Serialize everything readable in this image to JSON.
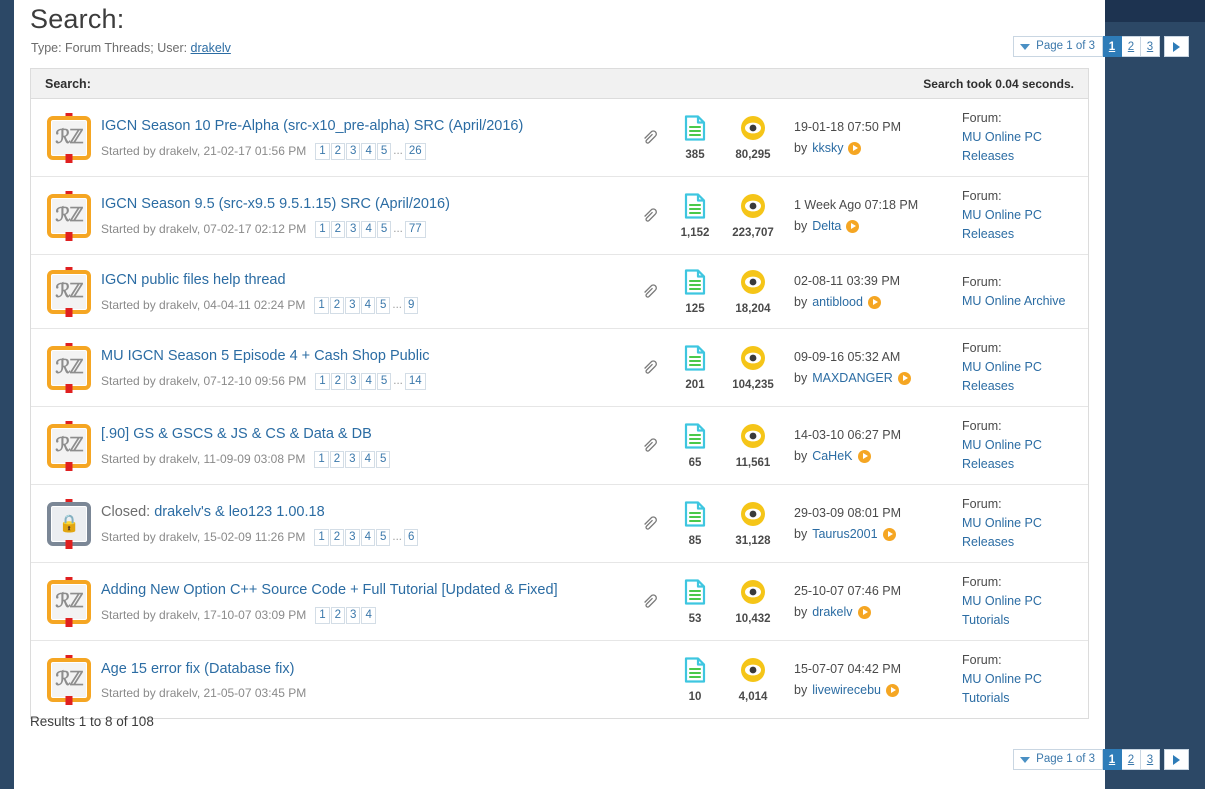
{
  "header": {
    "title": "Search:",
    "subline_prefix": "Type: Forum Threads; User: ",
    "subline_user": "drakelv"
  },
  "pagination": {
    "page_label": "Page 1 of 3",
    "pages": [
      "1",
      "2",
      "3"
    ],
    "active_page": "1",
    "next_label": "▶"
  },
  "panel": {
    "heading": "Search:",
    "took": "Search took 0.04 seconds."
  },
  "icons": {
    "thread_glyph": "ℛℤ",
    "closed_glyph": "🔒",
    "attachment": "paperclip-icon",
    "replies": "document-icon",
    "views": "eye-icon",
    "goto": "goto-arrow-icon"
  },
  "labels": {
    "forum_prefix": "Forum:",
    "by_prefix": "by",
    "results_count": "Results 1 to 8 of 108",
    "dots": "..."
  },
  "results": [
    {
      "icon": "thread",
      "closed_prefix": "",
      "title": "IGCN Season 10 Pre-Alpha (src-x10_pre-alpha) SRC (April/2016)",
      "started": "Started by drakelv, 21-02-17 01:56 PM",
      "minipages": [
        "1",
        "2",
        "3",
        "4",
        "5"
      ],
      "last_minipage": "26",
      "has_attachment": true,
      "replies": "385",
      "views": "80,295",
      "last_post_date": "19-01-18 07:50 PM",
      "last_post_user": "kksky",
      "forum": "MU Online PC Releases"
    },
    {
      "icon": "thread",
      "closed_prefix": "",
      "title": "IGCN Season 9.5 (src-x9.5 9.5.1.15) SRC (April/2016)",
      "started": "Started by drakelv, 07-02-17 02:12 PM",
      "minipages": [
        "1",
        "2",
        "3",
        "4",
        "5"
      ],
      "last_minipage": "77",
      "has_attachment": true,
      "replies": "1,152",
      "views": "223,707",
      "last_post_date": "1 Week Ago 07:18 PM",
      "last_post_user": "Delta",
      "forum": "MU Online PC Releases"
    },
    {
      "icon": "thread",
      "closed_prefix": "",
      "title": "IGCN public files help thread",
      "started": "Started by drakelv, 04-04-11 02:24 PM",
      "minipages": [
        "1",
        "2",
        "3",
        "4",
        "5"
      ],
      "last_minipage": "9",
      "has_attachment": true,
      "replies": "125",
      "views": "18,204",
      "last_post_date": "02-08-11 03:39 PM",
      "last_post_user": "antiblood",
      "forum": "MU Online Archive"
    },
    {
      "icon": "thread",
      "closed_prefix": "",
      "title": "MU IGCN Season 5 Episode 4 + Cash Shop Public",
      "started": "Started by drakelv, 07-12-10 09:56 PM",
      "minipages": [
        "1",
        "2",
        "3",
        "4",
        "5"
      ],
      "last_minipage": "14",
      "has_attachment": true,
      "replies": "201",
      "views": "104,235",
      "last_post_date": "09-09-16 05:32 AM",
      "last_post_user": "MAXDANGER",
      "forum": "MU Online PC Releases"
    },
    {
      "icon": "thread",
      "closed_prefix": "",
      "title": "[.90] GS & GSCS & JS & CS & Data & DB",
      "started": "Started by drakelv, 11-09-09 03:08 PM",
      "minipages": [
        "1",
        "2",
        "3",
        "4",
        "5"
      ],
      "last_minipage": "",
      "has_attachment": true,
      "replies": "65",
      "views": "11,561",
      "last_post_date": "14-03-10 06:27 PM",
      "last_post_user": "CaHeK",
      "forum": "MU Online PC Releases"
    },
    {
      "icon": "closed",
      "closed_prefix": "Closed: ",
      "title": "drakelv's & leo123 1.00.18",
      "started": "Started by drakelv, 15-02-09 11:26 PM",
      "minipages": [
        "1",
        "2",
        "3",
        "4",
        "5"
      ],
      "last_minipage": "6",
      "has_attachment": true,
      "replies": "85",
      "views": "31,128",
      "last_post_date": "29-03-09 08:01 PM",
      "last_post_user": "Taurus2001",
      "forum": "MU Online PC Releases"
    },
    {
      "icon": "thread",
      "closed_prefix": "",
      "title": "Adding New Option C++ Source Code + Full Tutorial [Updated & Fixed]",
      "started": "Started by drakelv, 17-10-07 03:09 PM",
      "minipages": [
        "1",
        "2",
        "3",
        "4"
      ],
      "last_minipage": "",
      "has_attachment": true,
      "replies": "53",
      "views": "10,432",
      "last_post_date": "25-10-07 07:46 PM",
      "last_post_user": "drakelv",
      "forum": "MU Online PC Tutorials"
    },
    {
      "icon": "thread",
      "closed_prefix": "",
      "title": "Age 15 error fix (Database fix)",
      "started": "Started by drakelv, 21-05-07 03:45 PM",
      "minipages": [],
      "last_minipage": "",
      "has_attachment": false,
      "replies": "10",
      "views": "4,014",
      "last_post_date": "15-07-07 04:42 PM",
      "last_post_user": "livewirecebu",
      "forum": "MU Online PC Tutorials"
    }
  ],
  "colors": {
    "link": "#2b6ca3",
    "accent_orange": "#f5a623",
    "active_page": "#2e7cb8",
    "rail": "#2c4866"
  }
}
